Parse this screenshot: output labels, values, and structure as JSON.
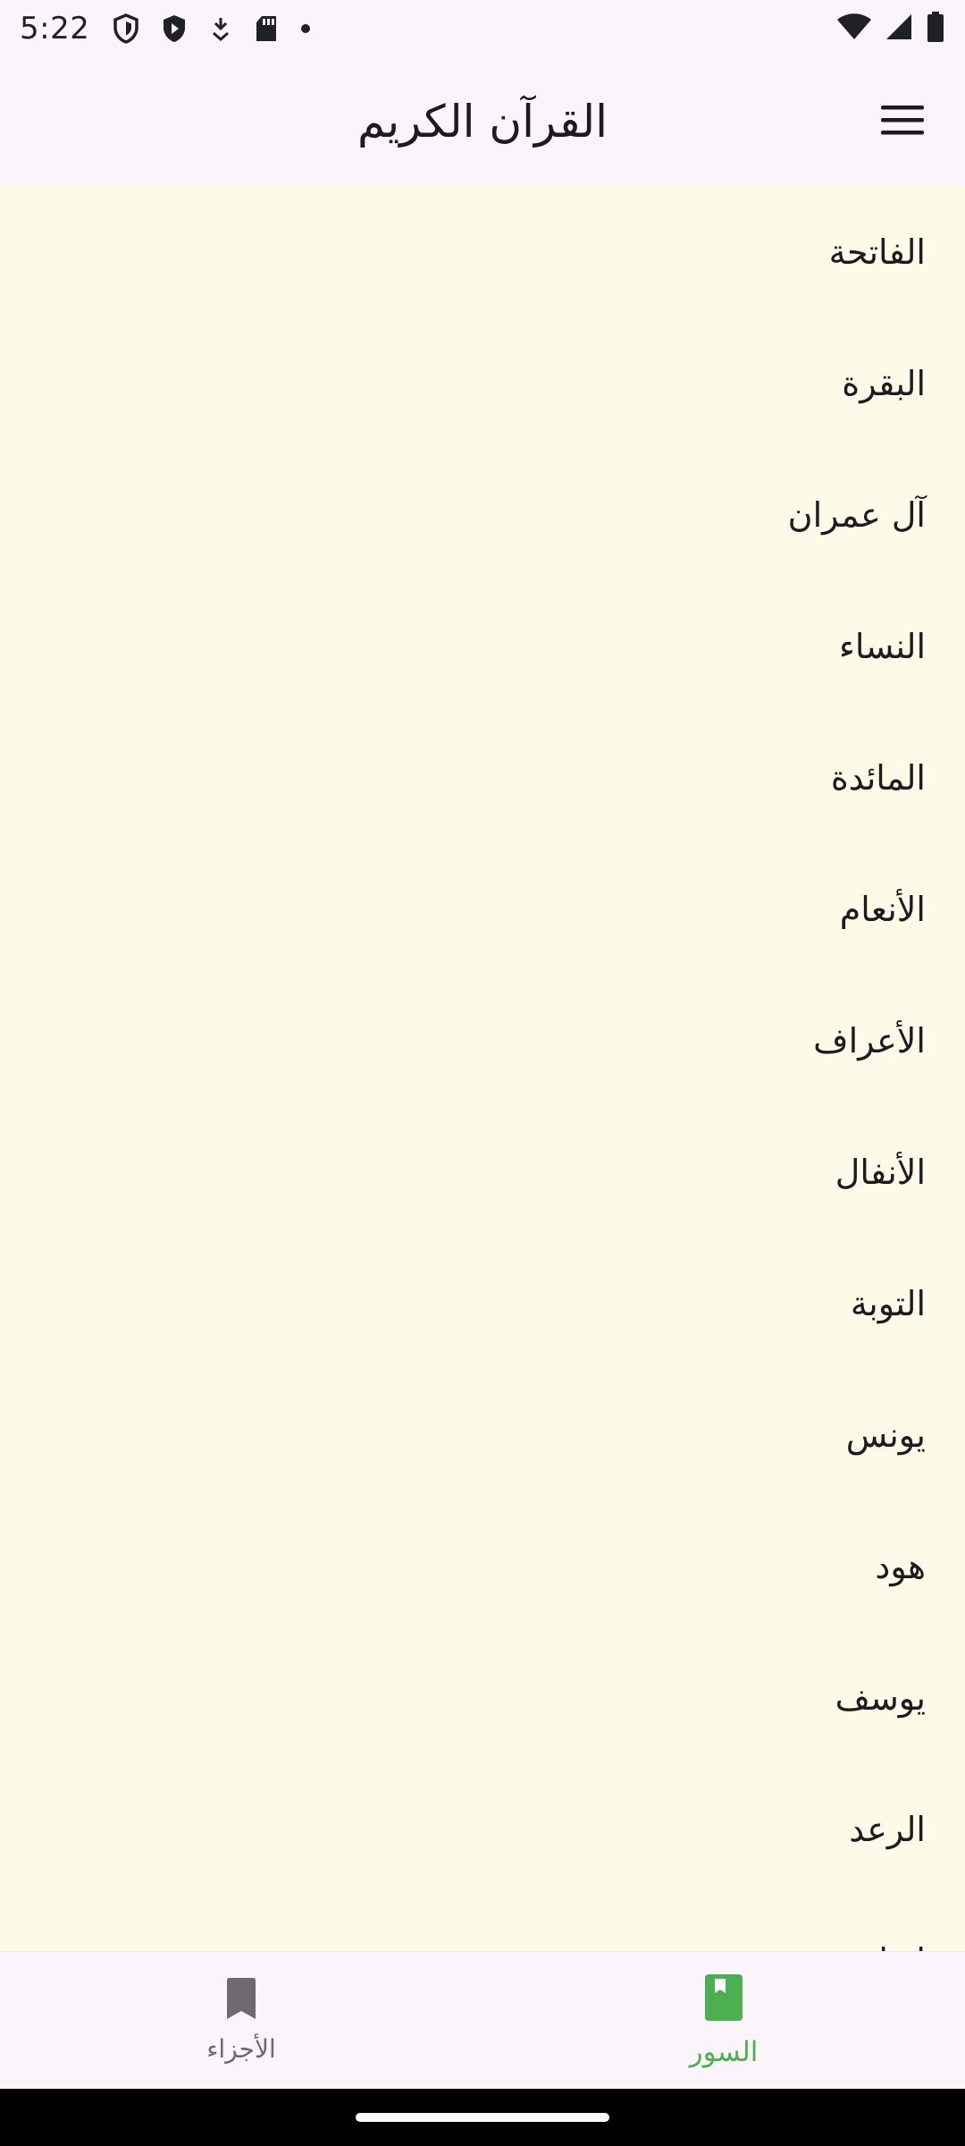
{
  "status_bar": {
    "time": "5:22",
    "icons": [
      "vpn-shield-icon",
      "play-protect-icon",
      "download-icon",
      "sd-card-icon",
      "dot-icon",
      "wifi-icon",
      "signal-icon",
      "battery-icon"
    ]
  },
  "app_bar": {
    "title": "القرآن الكريم",
    "menu_icon": "hamburger-menu-icon"
  },
  "surah_list": {
    "items": [
      "الفاتحة",
      "البقرة",
      "آل عمران",
      "النساء",
      "المائدة",
      "الأنعام",
      "الأعراف",
      "الأنفال",
      "التوبة",
      "يونس",
      "هود",
      "يوسف",
      "الرعد",
      "إبراهيم"
    ]
  },
  "bottom_nav": {
    "ajza_label": "الأجزاء",
    "suwar_label": "السور",
    "active_tab": "suwar",
    "active_color": "#4caf50",
    "inactive_color": "#6f6a70"
  },
  "colors": {
    "list_background": "#fdfbe8",
    "bar_background": "#fbf5fb"
  }
}
